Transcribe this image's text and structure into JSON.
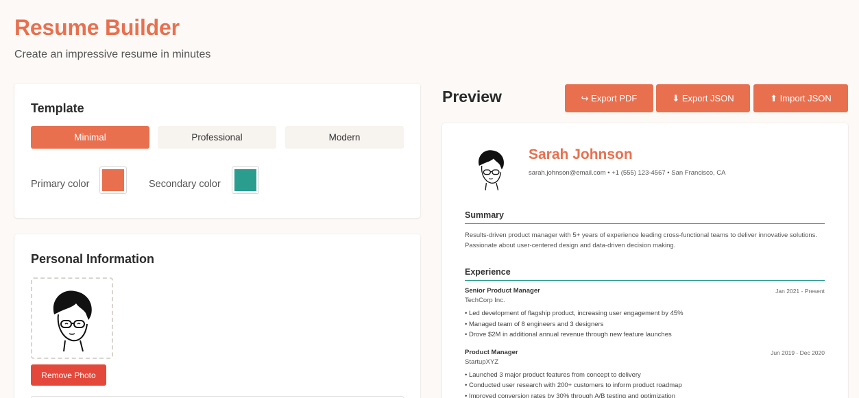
{
  "header": {
    "title": "Resume Builder",
    "subtitle": "Create an impressive resume in minutes"
  },
  "template_card": {
    "title": "Template",
    "options": [
      "Minimal",
      "Professional",
      "Modern"
    ],
    "selected": "Minimal",
    "primary_color_label": "Primary color",
    "secondary_color_label": "Secondary color",
    "primary_color": "#e8704f",
    "secondary_color": "#2a9d8f"
  },
  "personal_card": {
    "title": "Personal Information",
    "remove_photo_label": "Remove Photo"
  },
  "preview": {
    "title": "Preview",
    "export_pdf_label": "↪ Export PDF",
    "export_json_label": "⬇ Export JSON",
    "import_json_label": "⬆ Import JSON"
  },
  "resume": {
    "name": "Sarah Johnson",
    "contact": "sarah.johnson@email.com • +1 (555) 123-4567 • San Francisco, CA",
    "summary_heading": "Summary",
    "summary_text": "Results-driven product manager with 5+ years of experience leading cross-functional teams to deliver innovative solutions. Passionate about user-centered design and data-driven decision making.",
    "experience_heading": "Experience",
    "jobs": [
      {
        "title": "Senior Product Manager",
        "company": "TechCorp Inc.",
        "dates": "Jan 2021 - Present",
        "bullets": [
          "Led development of flagship product, increasing user engagement by 45%",
          "Managed team of 8 engineers and 3 designers",
          "Drove $2M in additional annual revenue through new feature launches"
        ]
      },
      {
        "title": "Product Manager",
        "company": "StartupXYZ",
        "dates": "Jun 2019 - Dec 2020",
        "bullets": [
          "Launched 3 major product features from concept to delivery",
          "Conducted user research with 200+ customers to inform product roadmap",
          "Improved conversion rates by 30% through A/B testing and optimization"
        ]
      }
    ]
  }
}
